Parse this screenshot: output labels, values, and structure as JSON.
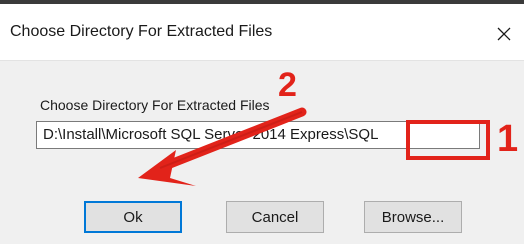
{
  "window": {
    "title": "Choose Directory For Extracted Files",
    "close_glyph": "✕"
  },
  "form": {
    "label": "Choose Directory For Extracted Files",
    "path_value": "D:\\Install\\Microsoft SQL Server 2014 Express\\SQL"
  },
  "buttons": {
    "ok_label": "Ok",
    "cancel_label": "Cancel",
    "browse_label": "Browse..."
  },
  "annotations": {
    "marker_1": "1",
    "marker_2": "2",
    "color": "#e2231a"
  },
  "colors": {
    "focus_border": "#0078d7",
    "client_bg": "#f0f0f0"
  }
}
